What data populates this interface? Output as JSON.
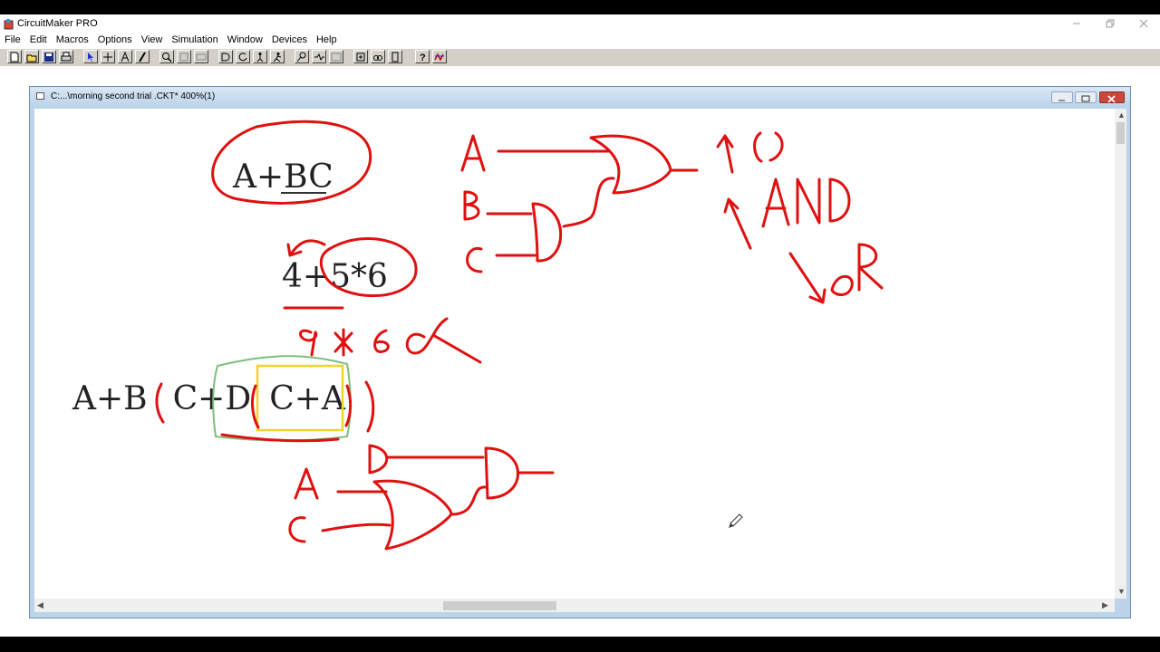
{
  "app": {
    "title": "CircuitMaker PRO",
    "window_controls": [
      "minimize",
      "restore",
      "close"
    ]
  },
  "menu": [
    "File",
    "Edit",
    "Macros",
    "Options",
    "View",
    "Simulation",
    "Window",
    "Devices",
    "Help"
  ],
  "toolbar": {
    "buttons": [
      "new-icon",
      "open-icon",
      "save-icon",
      "print-icon",
      "arrow-tool-icon",
      "wire-tool-icon",
      "text-tool-icon",
      "probe-tool-icon",
      "zoom-icon",
      "zoom-fit-icon",
      "zoom-page-icon",
      "digital-icon",
      "reset-icon",
      "step-icon",
      "run-icon",
      "trace-icon",
      "probe-icon",
      "bus-icon",
      "macro-icon",
      "library-icon",
      "device-icon",
      "help-icon",
      "analog-icon"
    ]
  },
  "document": {
    "title": "C:...\\morning second trial .CKT* 400%(1)"
  },
  "canvas": {
    "expr1": "A+BC",
    "expr1_underlined": "BC",
    "expr2": "4+5*6",
    "expr2_result": "9 * 6",
    "expr3_a": "A+B",
    "expr3_b": "C+D",
    "expr3_c": "C+A",
    "gate_labels_top": [
      "A",
      "B",
      "C"
    ],
    "gate_labels_bottom": [
      "D",
      "A",
      "C"
    ],
    "notes": [
      "( )",
      "AND",
      "OR"
    ]
  },
  "colors": {
    "ink": "#e01010",
    "green_box": "#7cbf7a",
    "yellow_box": "#f2d22b"
  }
}
